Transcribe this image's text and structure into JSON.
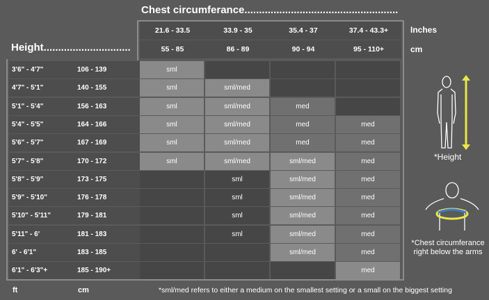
{
  "titles": {
    "chest": "Chest circumferance.....................................................",
    "height": "Height..............................",
    "inches": "Inches",
    "cm": "cm"
  },
  "header_inches": [
    "21.6 - 33.5",
    "33.9 - 35",
    "35.4 - 37",
    "37.4 - 43.3+"
  ],
  "header_cm": [
    "55 - 85",
    "86 - 89",
    "90 - 94",
    "95 - 110+"
  ],
  "rows": [
    {
      "ft": "3'6\" - 4'7\"",
      "cm": "106 - 139",
      "v": [
        "sml",
        "",
        "",
        ""
      ]
    },
    {
      "ft": "4'7\" - 5'1\"",
      "cm": "140 - 155",
      "v": [
        "sml",
        "sml/med",
        "",
        ""
      ]
    },
    {
      "ft": "5'1\" - 5'4\"",
      "cm": "156 - 163",
      "v": [
        "sml",
        "sml/med",
        "med",
        ""
      ]
    },
    {
      "ft": "5'4\" - 5'5\"",
      "cm": "164 - 166",
      "v": [
        "sml",
        "sml/med",
        "med",
        "med"
      ]
    },
    {
      "ft": "5'6\" - 5'7\"",
      "cm": "167 - 169",
      "v": [
        "sml",
        "sml/med",
        "med",
        "med"
      ]
    },
    {
      "ft": "5'7\" - 5'8\"",
      "cm": "170 - 172",
      "v": [
        "sml",
        "sml/med",
        "sml/med",
        "med"
      ]
    },
    {
      "ft": "5'8\" - 5'9\"",
      "cm": "173 - 175",
      "v": [
        "",
        "sml",
        "sml/med",
        "med"
      ]
    },
    {
      "ft": "5'9\" - 5'10\"",
      "cm": "176 - 178",
      "v": [
        "",
        "sml",
        "sml/med",
        "med"
      ]
    },
    {
      "ft": "5'10\" - 5'11\"",
      "cm": "179 - 181",
      "v": [
        "",
        "sml",
        "sml/med",
        "med"
      ]
    },
    {
      "ft": "5'11\" - 6'",
      "cm": "181 - 183",
      "v": [
        "",
        "sml",
        "sml/med",
        "med"
      ]
    },
    {
      "ft": "6' - 6'1\"",
      "cm": "183 - 185",
      "v": [
        "",
        "",
        "sml/med",
        "med"
      ]
    },
    {
      "ft": "6'1\" - 6'3\"+",
      "cm": "185 - 190+",
      "v": [
        "",
        "",
        "",
        "med"
      ]
    }
  ],
  "shades": [
    [
      "light",
      "dark",
      "dark",
      "dark"
    ],
    [
      "light",
      "light",
      "dark",
      "dark"
    ],
    [
      "light",
      "light",
      "mid",
      "dark"
    ],
    [
      "light",
      "light",
      "mid",
      "mid"
    ],
    [
      "light",
      "light",
      "mid",
      "mid"
    ],
    [
      "light",
      "light",
      "light",
      "mid"
    ],
    [
      "dark",
      "dark",
      "light",
      "mid"
    ],
    [
      "dark",
      "dark",
      "light",
      "mid"
    ],
    [
      "dark",
      "dark",
      "light",
      "mid"
    ],
    [
      "dark",
      "dark",
      "light",
      "mid"
    ],
    [
      "dark",
      "dark",
      "light",
      "mid"
    ],
    [
      "dark",
      "dark",
      "dark",
      "light"
    ]
  ],
  "footer": {
    "ft": "ft",
    "cm": "cm",
    "note": "*sml/med refers to either a medium on the smallest setting or a small on the biggest setting"
  },
  "captions": {
    "height": "*Height",
    "chest_line1": "*Chest circumferance",
    "chest_line2": "right below the arms"
  },
  "colors": {
    "accent": "#e8e84a",
    "band": "#3a7bd5"
  }
}
